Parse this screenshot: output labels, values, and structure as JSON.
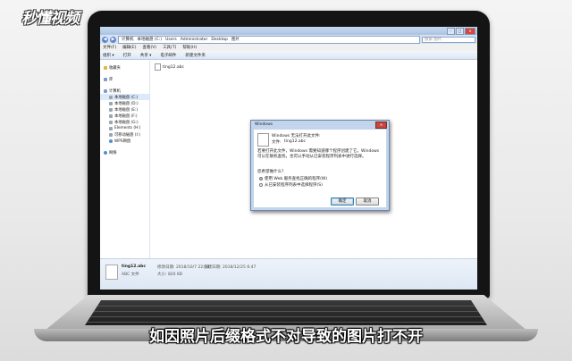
{
  "watermark": {
    "logo": "秒懂视频"
  },
  "caption": "如因照片后缀格式不对导致的图片打不开",
  "explorer": {
    "window_buttons": {
      "minimize": "–",
      "maximize": "□",
      "close": "✕"
    },
    "nav": {
      "back": "◀",
      "forward": "▶"
    },
    "address": [
      "计算机",
      "本地磁盘 (C:)",
      "Users",
      "Administrator",
      "Desktop",
      "图片"
    ],
    "search_placeholder": "搜索 图片",
    "menu": [
      "文件(F)",
      "编辑(E)",
      "查看(V)",
      "工具(T)",
      "帮助(H)"
    ],
    "toolbar": [
      "组织 ▾",
      "打开",
      "共享 ▾",
      "电子邮件",
      "新建文件夹"
    ],
    "sidebar": {
      "favorites": "收藏夹",
      "libraries": "库",
      "computer": "计算机",
      "drives": [
        "本地磁盘 (C:)",
        "本地磁盘 (D:)",
        "本地磁盘 (E:)",
        "本地磁盘 (F:)",
        "本地磁盘 (G:)",
        "Elements (H:)",
        "可移动磁盘 (I:)",
        "WPS网盘"
      ],
      "network": "网络"
    },
    "file": {
      "name": "ting12.abc"
    },
    "details": {
      "name": "ting12.abc",
      "type": "ABC 文件",
      "modified": "修改日期: 2018/10/7 22:58",
      "created": "创建日期: 2018/12/25 6:47",
      "size": "大小: 820 KB"
    }
  },
  "dialog": {
    "title": "Windows",
    "close": "✕",
    "heading": "Windows 无法打开此文件:",
    "file_label": "文件:",
    "file_name": "ting12.abc",
    "message": "若要打开此文件，Windows 需要知道哪个程序创建了它。Windows 可以在联机查找，也可以手动从已安装程序列表中进行选择。",
    "question": "您希望做什么？",
    "options": [
      "使用 Web 服务查找正确的程序(W)",
      "从已安装程序列表中选择程序(S)"
    ],
    "ok": "确定",
    "cancel": "取消"
  }
}
